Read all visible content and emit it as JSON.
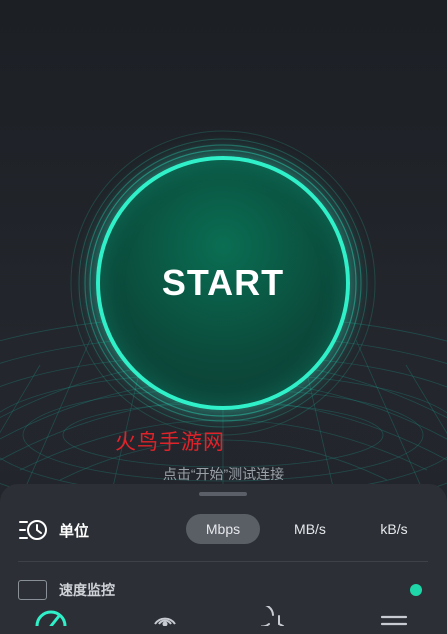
{
  "start": {
    "label": "START"
  },
  "watermark": "火鸟手游网",
  "hint": "点击“开始”测试连接",
  "units": {
    "title": "单位",
    "options": [
      "Mbps",
      "MB/s",
      "kB/s"
    ],
    "selected": "Mbps"
  },
  "speed_monitor": {
    "label": "速度监控"
  },
  "tabs": [
    "speed-test-tab",
    "signal-tab",
    "history-tab",
    "menu-tab"
  ],
  "colors": {
    "accent": "#2ff0c8",
    "background": "#1f2328",
    "sheet": "#2c3036",
    "watermark": "#e0232a"
  }
}
